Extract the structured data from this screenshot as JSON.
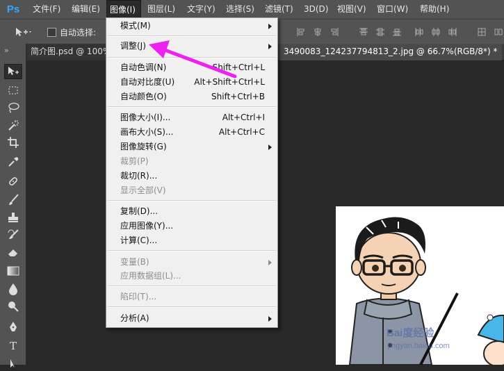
{
  "app": {
    "logo": "Ps"
  },
  "menubar": {
    "items": [
      {
        "label": "文件(F)"
      },
      {
        "label": "编辑(E)"
      },
      {
        "label": "图像(I)"
      },
      {
        "label": "图层(L)"
      },
      {
        "label": "文字(Y)"
      },
      {
        "label": "选择(S)"
      },
      {
        "label": "滤镜(T)"
      },
      {
        "label": "3D(D)"
      },
      {
        "label": "视图(V)"
      },
      {
        "label": "窗口(W)"
      },
      {
        "label": "帮助(H)"
      }
    ]
  },
  "options_bar": {
    "auto_select_label": "自动选择:",
    "auto_select_checked": false
  },
  "toolbox": {
    "collapse_glyph": "»",
    "type_tool_glyph": "T"
  },
  "tabs": [
    {
      "label": "简介图.psd @ 100%"
    },
    {
      "label": "3490083_124237794813_2.jpg @ 66.7%(RGB/8*) *"
    }
  ],
  "image_menu": {
    "items": [
      {
        "label": "模式(M)",
        "shortcut": "",
        "submenu": true,
        "disabled": false
      },
      {
        "label": "调整(J)",
        "shortcut": "",
        "submenu": true,
        "disabled": false
      },
      {
        "label": "自动色调(N)",
        "shortcut": "Shift+Ctrl+L",
        "submenu": false,
        "disabled": false
      },
      {
        "label": "自动对比度(U)",
        "shortcut": "Alt+Shift+Ctrl+L",
        "submenu": false,
        "disabled": false
      },
      {
        "label": "自动颜色(O)",
        "shortcut": "Shift+Ctrl+B",
        "submenu": false,
        "disabled": false
      },
      {
        "label": "图像大小(I)...",
        "shortcut": "Alt+Ctrl+I",
        "submenu": false,
        "disabled": false
      },
      {
        "label": "画布大小(S)...",
        "shortcut": "Alt+Ctrl+C",
        "submenu": false,
        "disabled": false
      },
      {
        "label": "图像旋转(G)",
        "shortcut": "",
        "submenu": true,
        "disabled": false
      },
      {
        "label": "裁剪(P)",
        "shortcut": "",
        "submenu": false,
        "disabled": true
      },
      {
        "label": "裁切(R)...",
        "shortcut": "",
        "submenu": false,
        "disabled": false
      },
      {
        "label": "显示全部(V)",
        "shortcut": "",
        "submenu": false,
        "disabled": true
      },
      {
        "label": "复制(D)...",
        "shortcut": "",
        "submenu": false,
        "disabled": false
      },
      {
        "label": "应用图像(Y)...",
        "shortcut": "",
        "submenu": false,
        "disabled": false
      },
      {
        "label": "计算(C)...",
        "shortcut": "",
        "submenu": false,
        "disabled": false
      },
      {
        "label": "变量(B)",
        "shortcut": "",
        "submenu": true,
        "disabled": true
      },
      {
        "label": "应用数据组(L)...",
        "shortcut": "",
        "submenu": false,
        "disabled": true
      },
      {
        "label": "陷印(T)...",
        "shortcut": "",
        "submenu": false,
        "disabled": true
      },
      {
        "label": "分析(A)",
        "shortcut": "",
        "submenu": true,
        "disabled": false
      }
    ]
  },
  "watermark": {
    "text": "Bai度经验",
    "subtext": "jingyan.baidu.com"
  },
  "colors": {
    "annotation_arrow": "#ee22ee",
    "menu_bg": "#f0f0f0",
    "ui_bg": "#535353",
    "canvas_bg": "#282828"
  }
}
